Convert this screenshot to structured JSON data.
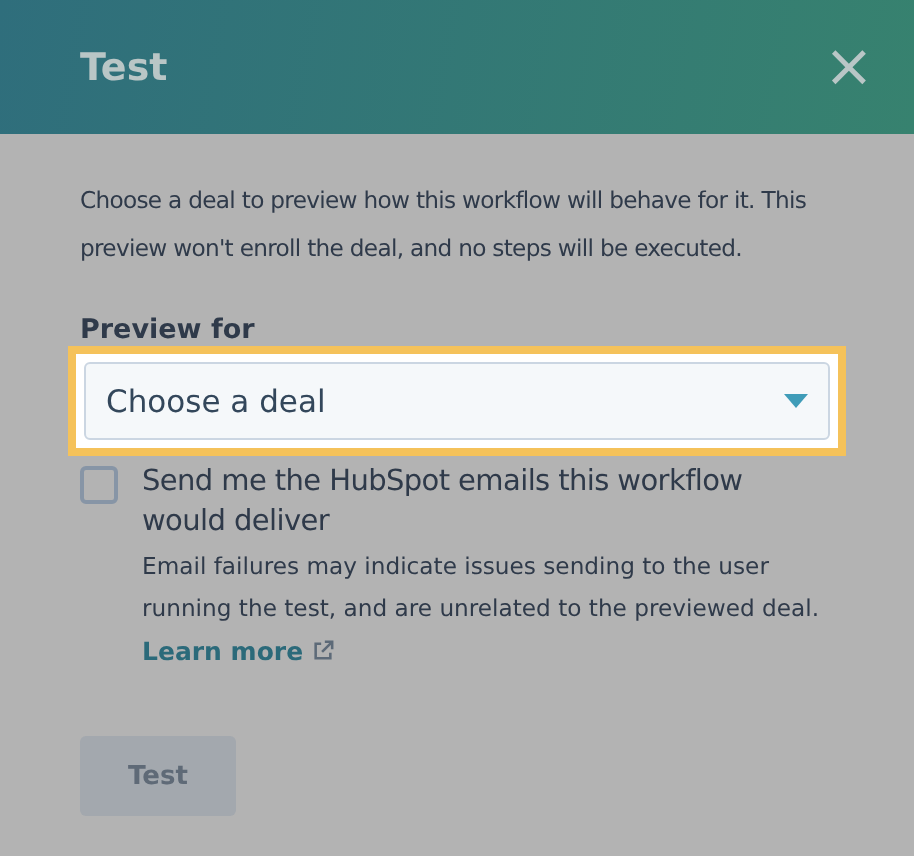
{
  "dialog": {
    "title": "Test",
    "close_icon": "×"
  },
  "description": "Choose a deal to preview how this workflow will behave for it. This preview won't enroll the deal, and no steps will be executed.",
  "preview_for": {
    "label": "Preview for",
    "placeholder": "Choose a deal",
    "highlighted": true
  },
  "email_option": {
    "label": "Send me the HubSpot emails this workflow would deliver",
    "checked": false,
    "help": "Email failures may indicate issues sending to the user running the test, and are unrelated to the previewed deal.",
    "link": "Learn more"
  },
  "test_button": {
    "label": "Test",
    "disabled": true
  }
}
